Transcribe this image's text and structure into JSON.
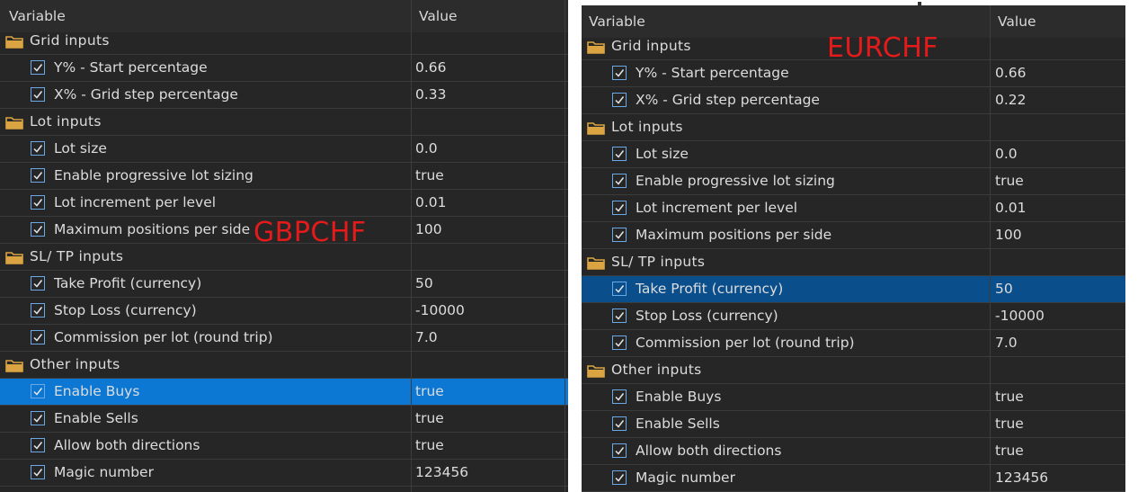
{
  "headers": {
    "variable": "Variable",
    "value": "Value"
  },
  "annotations": {
    "left": "GBPCHF",
    "right": "EURCHF",
    "color": "#e51b1b"
  },
  "colors": {
    "selection_left": "#0c78d4",
    "selection_right": "#0a4f8c",
    "folder": "#d9a441",
    "checkbox": "#6aa9e6"
  },
  "left": {
    "rows": [
      {
        "type": "group",
        "name": "Grid inputs"
      },
      {
        "type": "item",
        "name": "Y% - Start percentage",
        "value": "0.66"
      },
      {
        "type": "item",
        "name": "X% - Grid step percentage",
        "value": "0.33"
      },
      {
        "type": "group",
        "name": "Lot inputs"
      },
      {
        "type": "item",
        "name": "Lot size",
        "value": "0.0"
      },
      {
        "type": "item",
        "name": "Enable progressive lot sizing",
        "value": "true"
      },
      {
        "type": "item",
        "name": "Lot increment per level",
        "value": "0.01"
      },
      {
        "type": "item",
        "name": "Maximum positions per side",
        "value": "100"
      },
      {
        "type": "group",
        "name": "SL/ TP inputs"
      },
      {
        "type": "item",
        "name": "Take Profit (currency)",
        "value": "50"
      },
      {
        "type": "item",
        "name": "Stop Loss (currency)",
        "value": "-10000"
      },
      {
        "type": "item",
        "name": "Commission per lot (round trip)",
        "value": "7.0"
      },
      {
        "type": "group",
        "name": "Other inputs"
      },
      {
        "type": "item",
        "name": "Enable Buys",
        "value": "true",
        "selected": true
      },
      {
        "type": "item",
        "name": "Enable Sells",
        "value": "true"
      },
      {
        "type": "item",
        "name": "Allow both directions",
        "value": "true"
      },
      {
        "type": "item",
        "name": "Magic number",
        "value": "123456"
      }
    ]
  },
  "right": {
    "rows": [
      {
        "type": "group",
        "name": "Grid inputs"
      },
      {
        "type": "item",
        "name": "Y% - Start percentage",
        "value": "0.66"
      },
      {
        "type": "item",
        "name": "X% - Grid step percentage",
        "value": "0.22"
      },
      {
        "type": "group",
        "name": "Lot inputs"
      },
      {
        "type": "item",
        "name": "Lot size",
        "value": "0.0"
      },
      {
        "type": "item",
        "name": "Enable progressive lot sizing",
        "value": "true"
      },
      {
        "type": "item",
        "name": "Lot increment per level",
        "value": "0.01"
      },
      {
        "type": "item",
        "name": "Maximum positions per side",
        "value": "100"
      },
      {
        "type": "group",
        "name": "SL/ TP inputs"
      },
      {
        "type": "item",
        "name": "Take Profit (currency)",
        "value": "50",
        "selected": true
      },
      {
        "type": "item",
        "name": "Stop Loss (currency)",
        "value": "-10000"
      },
      {
        "type": "item",
        "name": "Commission per lot (round trip)",
        "value": "7.0"
      },
      {
        "type": "group",
        "name": "Other inputs"
      },
      {
        "type": "item",
        "name": "Enable Buys",
        "value": "true"
      },
      {
        "type": "item",
        "name": "Enable Sells",
        "value": "true"
      },
      {
        "type": "item",
        "name": "Allow both directions",
        "value": "true"
      },
      {
        "type": "item",
        "name": "Magic number",
        "value": "123456"
      }
    ]
  }
}
